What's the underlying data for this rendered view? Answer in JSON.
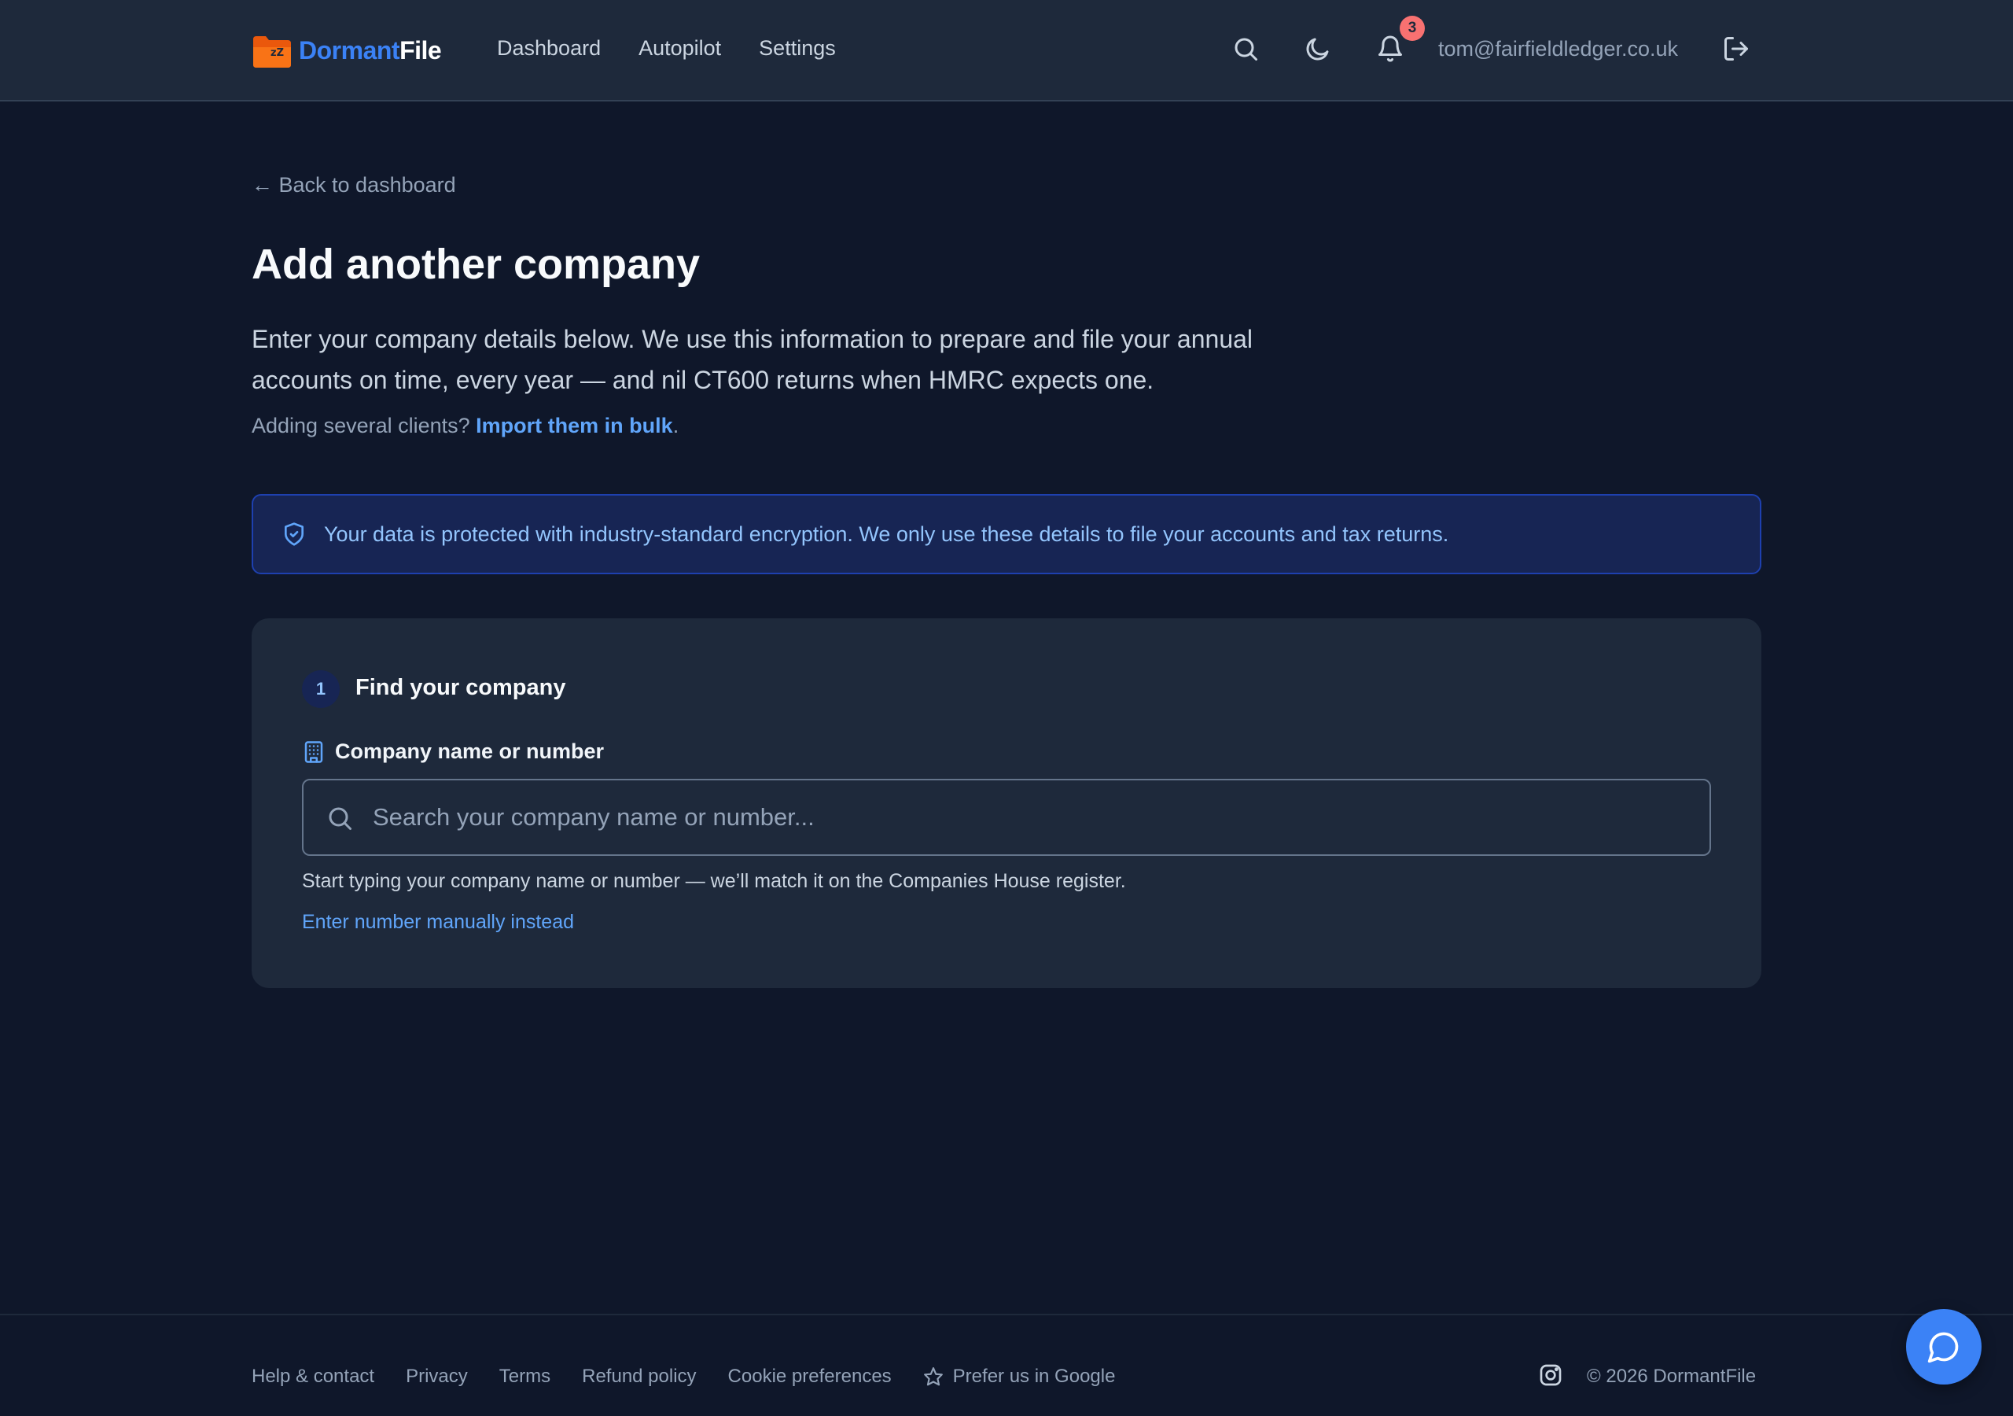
{
  "brand": {
    "part1": "Dormant",
    "part2": "File"
  },
  "nav": [
    {
      "label": "Dashboard"
    },
    {
      "label": "Autopilot"
    },
    {
      "label": "Settings"
    }
  ],
  "header": {
    "notification_count": "3",
    "user_email": "tom@fairfieldledger.co.uk",
    "icons": [
      "search-icon",
      "moon-icon",
      "bell-icon",
      "logout-icon"
    ]
  },
  "main": {
    "back_link": "← Back to dashboard",
    "title": "Add another company",
    "intro": "Enter your company details below. We use this information to prepare and file your annual accounts on time, every year — and nil CT600 returns when HMRC expects one.",
    "bulk_prefix": "Adding several clients? ",
    "bulk_link": "Import them in bulk",
    "bulk_suffix": ".",
    "notice": "Your data is protected with industry-standard encryption. We only use these details to file your accounts and tax returns."
  },
  "card": {
    "step_number": "1",
    "step_title": "Find your company",
    "field_label": "Company name or number",
    "search_placeholder": "Search your company name or number...",
    "search_value": "",
    "help_text": "Start typing your company name or number — we’ll match it on the Companies House register.",
    "manual_link": "Enter number manually instead"
  },
  "footer": {
    "links": [
      {
        "label": "Help & contact"
      },
      {
        "label": "Privacy"
      },
      {
        "label": "Terms"
      },
      {
        "label": "Refund policy"
      },
      {
        "label": "Cookie preferences"
      }
    ],
    "prefer_label": "Prefer us in Google",
    "copyright": "© 2026 DormantFile"
  },
  "colors": {
    "background": "#0f172a",
    "header": "#1e293b",
    "accent": "#3b82f6",
    "link": "#60a5fa",
    "logo_orange": "#f97316",
    "badge": "#f87171"
  }
}
